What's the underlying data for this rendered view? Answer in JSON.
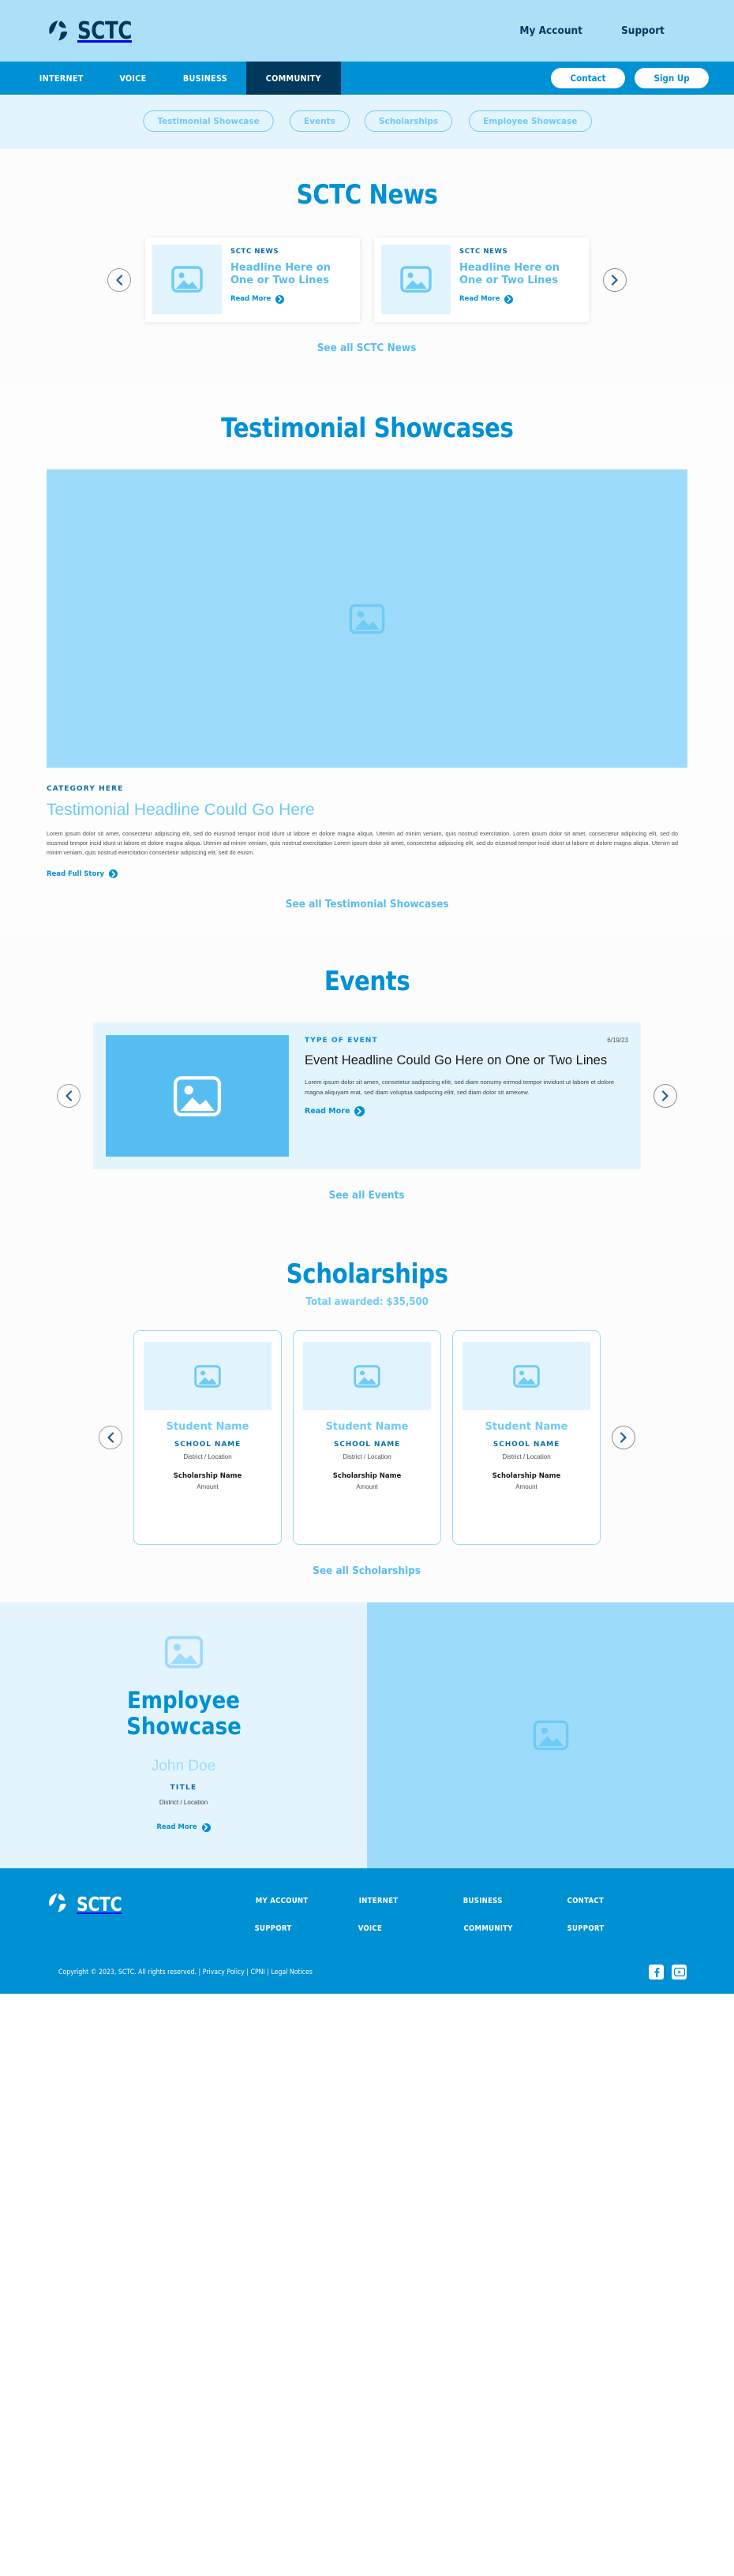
{
  "brand": {
    "name": "SCTC",
    "logo_icon": "sctc-circle-logo-icon"
  },
  "topbar": {
    "links": [
      {
        "label": "My Account"
      },
      {
        "label": "Support"
      }
    ]
  },
  "mainnav": {
    "items": [
      {
        "label": "INTERNET",
        "active": false
      },
      {
        "label": "VOICE",
        "active": false
      },
      {
        "label": "BUSINESS",
        "active": false
      },
      {
        "label": "COMMUNITY",
        "active": true
      }
    ],
    "buttons": [
      {
        "label": "Contact"
      },
      {
        "label": "Sign Up"
      }
    ]
  },
  "chipbar": {
    "chips": [
      {
        "label": "Testimonial Showcase"
      },
      {
        "label": "Events"
      },
      {
        "label": "Scholarships"
      },
      {
        "label": "Employee Showcase"
      }
    ]
  },
  "news": {
    "title": "SCTC News",
    "prev_icon": "chevron-left-icon",
    "next_icon": "chevron-right-icon",
    "cards": [
      {
        "kicker": "SCTC NEWS",
        "headline": "Headline Here on One or Two Lines",
        "read_more": "Read More",
        "thumb_icon": "image-placeholder-icon"
      },
      {
        "kicker": "SCTC NEWS",
        "headline": "Headline Here on One or Two Lines",
        "read_more": "Read More",
        "thumb_icon": "image-placeholder-icon"
      }
    ],
    "see_all": "See all SCTC News"
  },
  "testimonial": {
    "title": "Testimonial Showcases",
    "hero_icon": "image-placeholder-icon",
    "category": "CATEGORY HERE",
    "headline": "Testimonial Headline Could Go Here",
    "body": "Lorem ipsum dolor sit amet, consectetur adipiscing elit, sed do eiusmod tempor incid idunt ut labore et dolore magna aliqua. Utenim ad minim veniam, quis nostrud exercitation. Lorem ipsum dolor sit amet, consectetur adipiscing elit, sed do eiusmod tempor incid idunt ut labore et dolore magna aliqua. Utenim ad minim veniam, quis nostrud exercitation Lorem ipsum dolor sit amet, consectetur adipiscing elit, sed do eiusmod tempor incid idunt ut labore et dolore magna aliqua. Utenim ad minim veniam, quis nostrud exercitation consectetur adipiscing elit, sed do eiusm.",
    "read_full": "Read Full Story",
    "see_all": "See all Testimonial Showcases"
  },
  "events": {
    "title": "Events",
    "prev_icon": "chevron-left-icon",
    "next_icon": "chevron-right-icon",
    "card": {
      "kicker": "TYPE OF  EVENT",
      "date": "6/19/23",
      "headline": "Event Headline Could Go Here on One or Two Lines",
      "body": "Lorem ipsum dolor sit amen, consetetur sadipscing elitr, sed diam nonumy eirmod tempor invidunt ut labore et dolore magna aliquyam erat, sed diam voluptua sadipscing elitr, sed diam dolor sit amexew.",
      "read_more": "Read More",
      "thumb_icon": "image-placeholder-icon"
    },
    "see_all": "See all Events"
  },
  "scholarships": {
    "title": "Scholarships",
    "subtitle": "Total awarded: $35,500",
    "prev_icon": "chevron-left-icon",
    "next_icon": "chevron-right-icon",
    "cards": [
      {
        "student": "Student Name",
        "school": "SCHOOL NAME",
        "location": "District / Location",
        "program": "Scholarship Name",
        "amount": "Amount",
        "thumb_icon": "image-placeholder-icon"
      },
      {
        "student": "Student Name",
        "school": "SCHOOL NAME",
        "location": "District / Location",
        "program": "Scholarship Name",
        "amount": "Amount",
        "thumb_icon": "image-placeholder-icon"
      },
      {
        "student": "Student Name",
        "school": "SCHOOL NAME",
        "location": "District / Location",
        "program": "Scholarship Name",
        "amount": "Amount",
        "thumb_icon": "image-placeholder-icon"
      }
    ],
    "see_all": "See all Scholarships"
  },
  "employee": {
    "title_line1": "Employee",
    "title_line2": "Showcase",
    "name": "John Doe",
    "role": "TITLE",
    "location": "District / Location",
    "read_more": "Read More",
    "avatar_icon": "image-placeholder-icon",
    "photo_icon": "image-placeholder-icon"
  },
  "footer": {
    "columns": [
      {
        "links": [
          {
            "label": "MY ACCOUNT"
          },
          {
            "label": "SUPPORT"
          }
        ]
      },
      {
        "links": [
          {
            "label": "INTERNET"
          },
          {
            "label": "VOICE"
          }
        ]
      },
      {
        "links": [
          {
            "label": "BUSINESS"
          },
          {
            "label": "COMMUNITY"
          }
        ]
      },
      {
        "links": [
          {
            "label": "CONTACT"
          },
          {
            "label": "SUPPORT"
          }
        ]
      }
    ],
    "copyright": "Copyright © 2023, SCTC. All rights reserved.  | Privacy Policy  |  CPNI  |  Legal Notices",
    "social": [
      {
        "name": "facebook-icon"
      },
      {
        "name": "youtube-icon"
      }
    ]
  },
  "colors": {
    "brand_blue": "#0090d4",
    "dark_navy": "#00395c",
    "light_blue": "#9ddbfa",
    "pale_blue": "#e3f4fd",
    "sky": "#56bdf0"
  }
}
